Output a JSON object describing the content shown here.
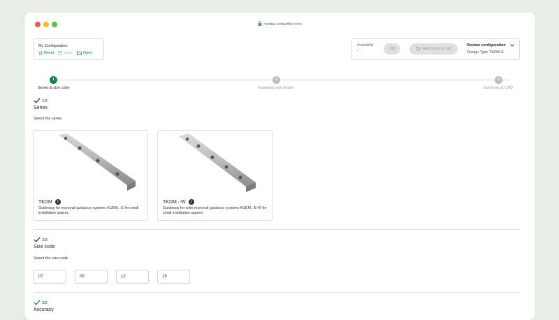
{
  "browser": {
    "url": "medias.schaeffler.com"
  },
  "config": {
    "title": "My Configuration",
    "reset_label": "Reset",
    "save_label": "Save",
    "open_label": "Open"
  },
  "availability": {
    "label": "Availability",
    "value": "-",
    "cad_label": "CAD",
    "cart_label": "Add items to cart",
    "review_label": "Review configuration",
    "design_type": "Design Type TKDM-E"
  },
  "steps": [
    {
      "number": "1",
      "label": "Series & size code",
      "state": "active"
    },
    {
      "number": "2",
      "label": "Guideway set details",
      "state": "inactive"
    },
    {
      "number": "3",
      "label": "Summary & CAD",
      "state": "inactive"
    }
  ],
  "series_section": {
    "count": "1/3",
    "title": "Series",
    "hint": "Select the series",
    "cards": [
      {
        "title": "TKDM",
        "description": "Guideway for monorail guidance systems KUEM..-E for small installation spaces"
      },
      {
        "title": "TKDM..-W",
        "description": "Guideway for wide monorail guidance systems KUEM..-E-W for small installation spaces"
      }
    ]
  },
  "size_section": {
    "count": "2/3",
    "title": "Size code",
    "hint": "Select the size code",
    "options": [
      "07",
      "09",
      "12",
      "15"
    ]
  },
  "accuracy_section": {
    "count": "3/3",
    "title": "Accuracy"
  },
  "colors": {
    "accent": "#00893d",
    "background": "#e8efe6",
    "inactive_step": "#bdbdbd"
  }
}
